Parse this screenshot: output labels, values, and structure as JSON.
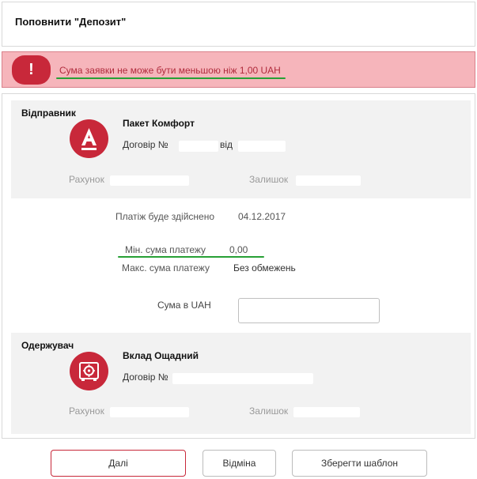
{
  "header": {
    "title": "Поповнити \"Депозит\""
  },
  "alert": {
    "icon": "!",
    "message": "Сума заявки не може бути меньшою ніж 1,00 UAH",
    "color": "#f6b5bb"
  },
  "sender": {
    "section_label": "Відправник",
    "product": "Пакет Комфорт",
    "contract_label": "Договір №",
    "contract_from": "від",
    "account_label": "Рахунок",
    "balance_label": "Залишок",
    "logo_icon": "alfa-bank-logo-icon"
  },
  "info": {
    "payment_date_label": "Платіж буде здійснено",
    "payment_date_value": "04.12.2017",
    "min_label": "Мін. сума платежу",
    "min_value": "0,00",
    "max_label": "Макс. сума платежу",
    "max_value": "Без обмежень",
    "amount_label": "Сума в UAH",
    "amount_value": ""
  },
  "receiver": {
    "section_label": "Одержувач",
    "product": "Вклад Ощадний",
    "contract_label": "Договір №",
    "account_label": "Рахунок",
    "balance_label": "Залишок",
    "logo_icon": "safe-icon"
  },
  "buttons": {
    "next": "Далі",
    "cancel": "Відміна",
    "save_template": "Зберегти шаблон"
  },
  "colors": {
    "accent": "#c8283a",
    "highlight": "#27a035"
  }
}
